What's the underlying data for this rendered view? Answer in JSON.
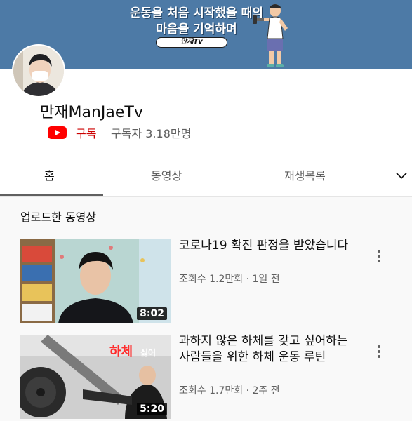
{
  "banner": {
    "line1": "운동을 처음 시작했을 때의",
    "line2": "마음을 기억하며",
    "pill": "만재Tv"
  },
  "channel": {
    "name": "만재ManJaeTv",
    "subscribe_label": "구독",
    "subscriber_count": "구독자 3.18만명"
  },
  "tabs": [
    {
      "label": "홈"
    },
    {
      "label": "동영상"
    },
    {
      "label": "재생목록"
    }
  ],
  "section": {
    "title": "업로드한 동영상"
  },
  "videos": [
    {
      "title": "코로나19 확진 판정을 받았습니다",
      "meta": "조회수 1.2만회 · 1일 전",
      "duration": "8:02"
    },
    {
      "title": "과하지 않은 하체를 갖고 싶어하는 사람들을 위한 하체 운동 루틴",
      "meta": "조회수 1.7만회 · 2주 전",
      "duration": "5:20",
      "overlay_word1": "하체",
      "overlay_word2": "싫어"
    }
  ],
  "icons": [
    "youtube-logo-icon",
    "chevron-down-icon",
    "more-vertical-icon"
  ],
  "colors": {
    "banner": "#4d7aa6",
    "subscribe": "#cc0000",
    "secondary_text": "#606060",
    "feed_background": "#f9f9f9"
  }
}
